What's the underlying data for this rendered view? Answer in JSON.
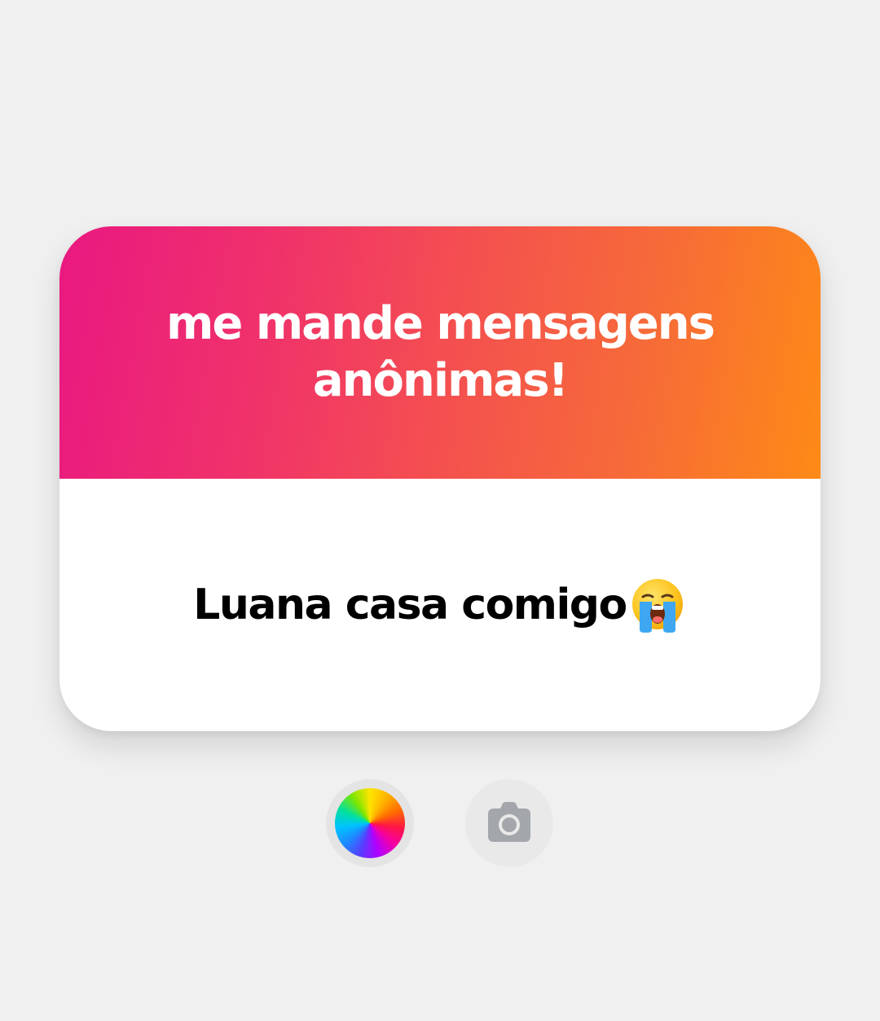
{
  "sticker": {
    "prompt": "me mande mensagens anônimas!",
    "answer": "Luana casa comigo",
    "answer_emoji": "loudly-crying-face-icon",
    "gradient_colors": [
      "#e91881",
      "#f4504f",
      "#fe8a16"
    ],
    "background_color": "#ffffff"
  },
  "controls": {
    "color_picker_icon": "color-wheel-icon",
    "camera_icon": "camera-icon"
  },
  "colors": {
    "page_background": "#f0f0f0",
    "prompt_text": "#ffffff",
    "answer_text": "#000000",
    "camera_icon": "#a3a6ab"
  }
}
